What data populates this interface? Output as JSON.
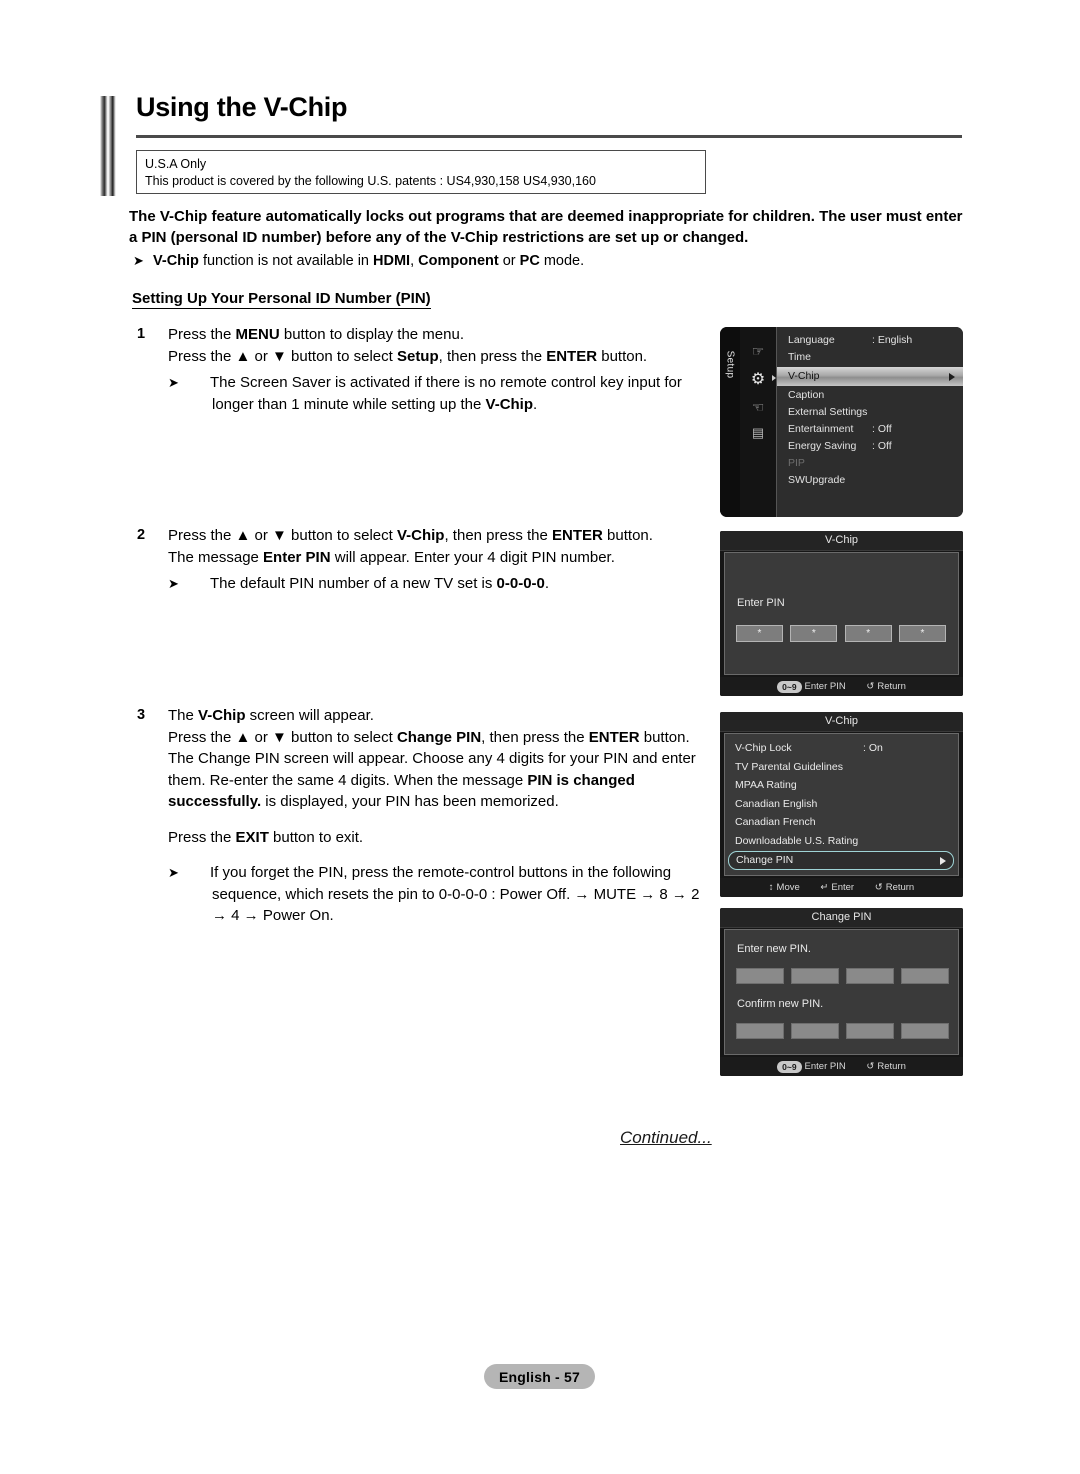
{
  "page": {
    "title": "Using the V-Chip",
    "continued_label": "Continued...",
    "footer_badge": "English - 57"
  },
  "notice_box": {
    "line1": "U.S.A Only",
    "line2": "This product is covered by the following U.S. patents : US4,930,158 US4,930,160"
  },
  "intro": {
    "text": "The V-Chip feature automatically locks out programs that are deemed inappropriate for children. The user must enter a PIN (personal ID number) before any of the V-Chip restrictions are set up or changed."
  },
  "note_hdmi": {
    "bullet": "➤",
    "text_parts": {
      "b1": "V-Chip",
      "t1": " function is not available in ",
      "b2": "HDMI",
      "t2": ", ",
      "b3": "Component",
      "t3": " or ",
      "b4": "PC",
      "t4": " mode."
    }
  },
  "subheading": "Setting Up Your Personal ID Number (PIN)",
  "steps": [
    {
      "number": "1",
      "line1_a": "Press the ",
      "line1_b": "MENU",
      "line1_c": " button to display the menu.",
      "line2_a": "Press the ▲ or ▼ button to select ",
      "line2_b": "Setup",
      "line2_c": ", then press the ",
      "line2_d": "ENTER",
      "line2_e": " button.",
      "note_bullet": "➤",
      "note_a": "The Screen Saver is activated if there is no remote control key input for longer than 1 minute while setting up the ",
      "note_b": "V-Chip",
      "note_c": "."
    },
    {
      "number": "2",
      "line1_a": "Press the ▲ or ▼ button to select ",
      "line1_b": "V-Chip",
      "line1_c": ", then press the ",
      "line1_d": "ENTER",
      "line1_e": " button.",
      "line2_a": "The message ",
      "line2_b": "Enter PIN",
      "line2_c": " will appear. Enter your 4 digit PIN number.",
      "note_bullet": "➤",
      "note_a": "The default PIN number of a new TV set is ",
      "note_b": "0-0-0-0",
      "note_c": "."
    },
    {
      "number": "3",
      "line1_a": "The ",
      "line1_b": "V-Chip",
      "line1_c": " screen will appear.",
      "line2_a": "Press the ▲ or ▼ button to select ",
      "line2_b": "Change PIN",
      "line2_c": ", then press the ",
      "line2_d": "ENTER",
      "line2_e": " button.",
      "line3_a": "The Change PIN screen will appear. Choose any 4 digits for your PIN and enter them. Re-enter the same 4 digits. When the message ",
      "line3_b": "PIN is changed successfully.",
      "line3_c": " is displayed, your PIN has been memorized.",
      "line4_a": "Press the ",
      "line4_b": "EXIT",
      "line4_c": " button to exit.",
      "note_bullet": "➤",
      "note_a": "If you forget the PIN, press the remote-control buttons in the following sequence, which resets the pin to 0-0-0-0 : Power Off. → MUTE → 8 → 2 → 4 → Power On."
    }
  ],
  "osd_setup": {
    "side_label": "Setup",
    "icons": [
      "hand-icon",
      "gear-icon",
      "plug-icon",
      "card-icon"
    ],
    "rows": [
      {
        "label": "Language",
        "value": ": English",
        "state": "normal"
      },
      {
        "label": "Time",
        "value": "",
        "state": "normal"
      },
      {
        "label": "V-Chip",
        "value": "",
        "state": "highlighted"
      },
      {
        "label": "Caption",
        "value": "",
        "state": "normal"
      },
      {
        "label": "External Settings",
        "value": "",
        "state": "normal"
      },
      {
        "label": "Entertainment",
        "value": ": Off",
        "state": "normal"
      },
      {
        "label": "Energy Saving",
        "value": ": Off",
        "state": "normal"
      },
      {
        "label": "PIP",
        "value": "",
        "state": "disabled"
      },
      {
        "label": "SWUpgrade",
        "value": "",
        "state": "normal"
      }
    ]
  },
  "osd_pin": {
    "title": "V-Chip",
    "label": "Enter PIN",
    "boxes": [
      "*",
      "*",
      "*",
      "*"
    ],
    "footer": {
      "key_pill": "0~9",
      "key_label": "Enter PIN",
      "return_glyph": "↺",
      "return_label": "Return"
    }
  },
  "osd_vchip": {
    "title": "V-Chip",
    "rows": [
      {
        "label": "V-Chip Lock",
        "value": ": On",
        "selected": false
      },
      {
        "label": "TV Parental Guidelines",
        "value": "",
        "selected": false
      },
      {
        "label": "MPAA Rating",
        "value": "",
        "selected": false
      },
      {
        "label": "Canadian English",
        "value": "",
        "selected": false
      },
      {
        "label": "Canadian French",
        "value": "",
        "selected": false
      },
      {
        "label": "Downloadable U.S. Rating",
        "value": "",
        "selected": false
      },
      {
        "label": "Change PIN",
        "value": "",
        "selected": true
      }
    ],
    "footer": {
      "move_glyph": "↕",
      "move_label": "Move",
      "enter_glyph": "↵",
      "enter_label": "Enter",
      "return_glyph": "↺",
      "return_label": "Return"
    }
  },
  "osd_change_pin": {
    "title": "Change PIN",
    "label_new": "Enter new PIN.",
    "label_confirm": "Confirm new PIN.",
    "boxes_new": [
      "",
      "",
      "",
      ""
    ],
    "boxes_confirm": [
      "",
      "",
      "",
      ""
    ],
    "footer": {
      "key_pill": "0~9",
      "key_label": "Enter PIN",
      "return_glyph": "↺",
      "return_label": "Return"
    }
  },
  "colors": {
    "page_bg": "#ffffff",
    "text": "#000000",
    "rule": "#4a4a4a",
    "osd_bg": "#1c1c1c",
    "osd_panel": "#3a3a3a",
    "osd_text": "#e2e2e2",
    "highlight_start": "#d6d6d6",
    "selection_border": "#9fd4d6",
    "badge_bg": "#b5b5b5"
  }
}
